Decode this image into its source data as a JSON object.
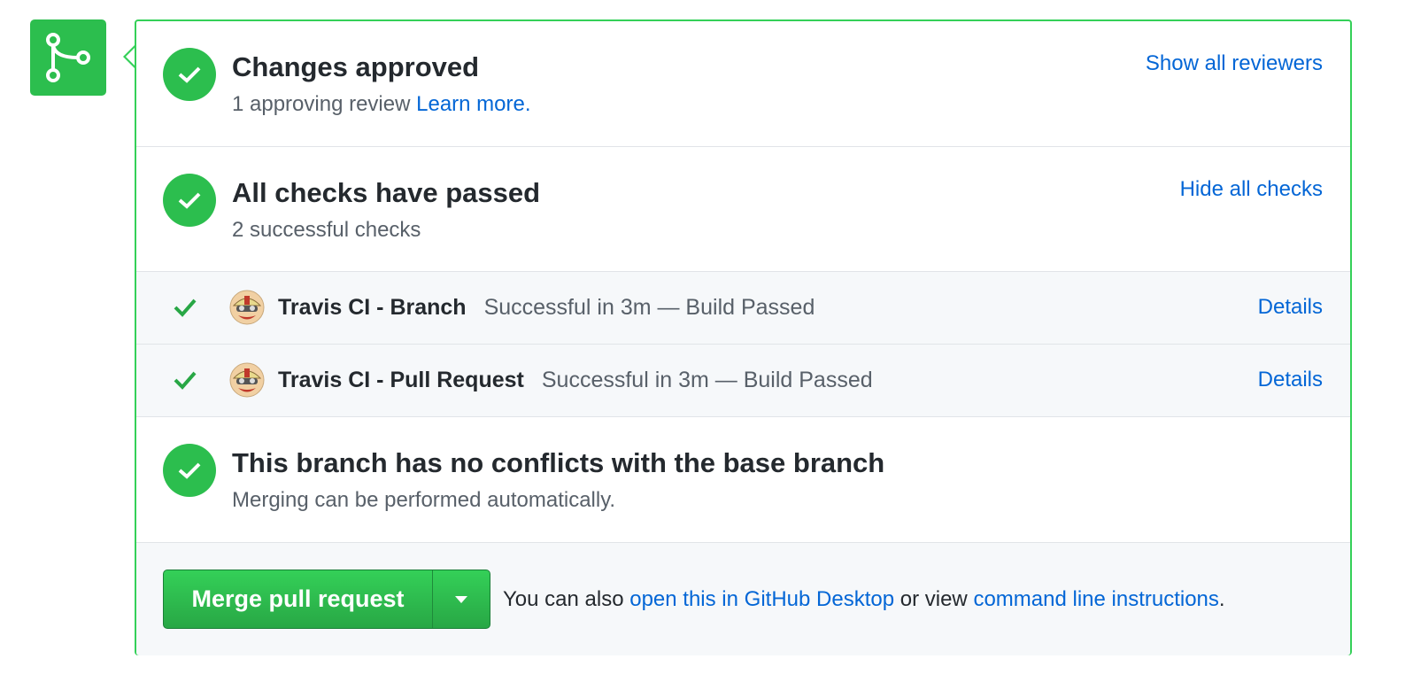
{
  "icons": {
    "merge_icon": "git-merge-icon",
    "check": "check-icon",
    "caret": "caret-down-icon",
    "avatar": "travis-ci-avatar"
  },
  "colors": {
    "success": "#2cbe4e",
    "link": "#0366d6",
    "muted": "#586069"
  },
  "approved": {
    "title": "Changes approved",
    "subtitle": "1 approving review",
    "learn_more": "Learn more.",
    "show_reviewers": "Show all reviewers"
  },
  "checks": {
    "title": "All checks have passed",
    "subtitle": "2 successful checks",
    "hide_checks": "Hide all checks",
    "rows": [
      {
        "name": "Travis CI - Branch",
        "desc": "Successful in 3m — Build Passed",
        "details": "Details"
      },
      {
        "name": "Travis CI - Pull Request",
        "desc": "Successful in 3m — Build Passed",
        "details": "Details"
      }
    ]
  },
  "conflicts": {
    "title": "This branch has no conflicts with the base branch",
    "subtitle": "Merging can be performed automatically."
  },
  "merge": {
    "button_label": "Merge pull request",
    "text_prefix": "You can also",
    "desktop_link": "open this in GitHub Desktop",
    "text_mid": "or view",
    "cli_link": "command line instructions",
    "text_suffix": "."
  }
}
